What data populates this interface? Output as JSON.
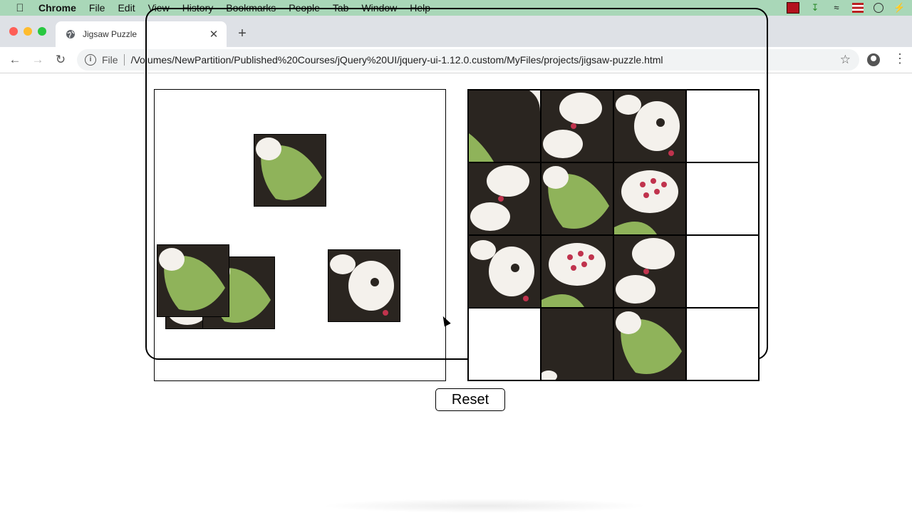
{
  "menubar": {
    "app_name": "Chrome",
    "items": [
      "File",
      "Edit",
      "View",
      "History",
      "Bookmarks",
      "People",
      "Tab",
      "Window",
      "Help"
    ]
  },
  "tab": {
    "title": "Jigsaw Puzzle"
  },
  "address": {
    "scheme_label": "File",
    "url": "/Volumes/NewPartition/Published%20Courses/jQuery%20UI/jquery-ui-1.12.0.custom/MyFiles/projects/jigsaw-puzzle.html"
  },
  "puzzle": {
    "reset_label": "Reset"
  },
  "colors": {
    "menubar_bg": "#a9d7b8",
    "tabstrip_bg": "#dee1e6",
    "petal": "#f4f1ec",
    "leaf": "#8fb35a",
    "dark_bg": "#2a2520",
    "stamen": "#c0334d"
  }
}
